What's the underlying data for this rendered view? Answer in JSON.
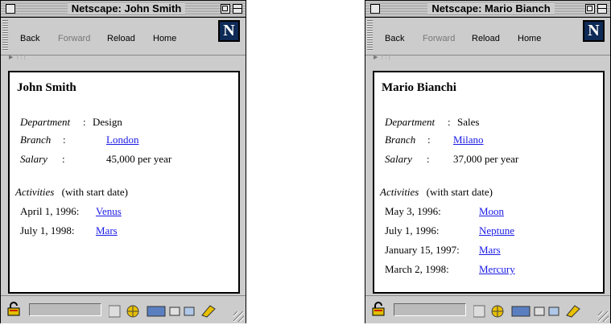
{
  "windows": [
    {
      "title": "Netscape: John Smith",
      "toolbar": {
        "back": "Back",
        "forward": "Forward",
        "reload": "Reload",
        "home": "Home",
        "logo": "N"
      },
      "location_tab": "▶ ⋮:⋮",
      "person": {
        "name": "John Smith",
        "fields": [
          {
            "label": "Department",
            "sep": ":",
            "value": "Design",
            "is_link": false
          },
          {
            "label": "Branch",
            "sep": ":",
            "value": "London",
            "is_link": true
          },
          {
            "label": "Salary",
            "sep": ":",
            "value": "45,000 per year",
            "is_link": false
          }
        ],
        "activities_label": "Activities",
        "activities_note": "(with start date)",
        "activities": [
          {
            "date": "April 1, 1996:",
            "name": "Venus"
          },
          {
            "date": "July 1, 1998:",
            "name": "Mars"
          }
        ]
      }
    },
    {
      "title": "Netscape: Mario Bianch",
      "toolbar": {
        "back": "Back",
        "forward": "Forward",
        "reload": "Reload",
        "home": "Home",
        "logo": "N"
      },
      "location_tab": "▶ ⋮:⋮",
      "person": {
        "name": "Mario Bianchi",
        "fields": [
          {
            "label": "Department",
            "sep": ":",
            "value": "Sales",
            "is_link": false
          },
          {
            "label": "Branch",
            "sep": ":",
            "value": "Milano",
            "is_link": true
          },
          {
            "label": "Salary",
            "sep": ":",
            "value": "37,000 per year",
            "is_link": false
          }
        ],
        "activities_label": "Activities",
        "activities_note": "(with start date)",
        "activities": [
          {
            "date": "May 3, 1996:",
            "name": "Moon"
          },
          {
            "date": "July 1, 1996:",
            "name": "Neptune"
          },
          {
            "date": "January 15, 1997:",
            "name": "Mars"
          },
          {
            "date": "March 2, 1998:",
            "name": "Mercury"
          }
        ]
      }
    }
  ],
  "colors": {
    "link": "#1a1ae6",
    "chrome": "#cccccc",
    "logo_bg": "#0e2a56"
  },
  "icons": [
    "close-box-icon",
    "zoom-box-icon",
    "collapse-box-icon",
    "drag-grip-icon",
    "netscape-n-logo-icon",
    "security-lock-icon",
    "component-bar-icons",
    "resize-grip-icon"
  ]
}
